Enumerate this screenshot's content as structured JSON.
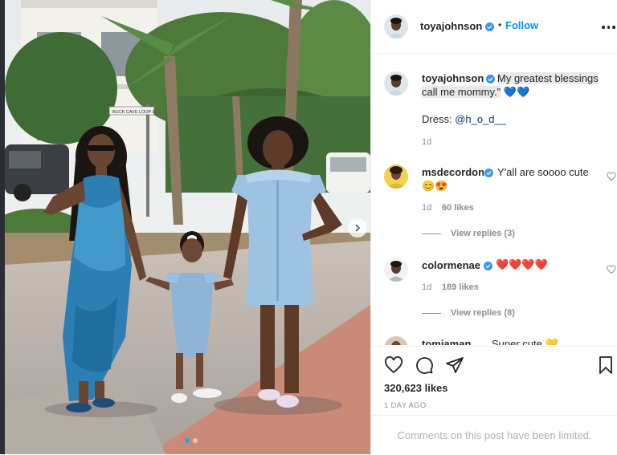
{
  "post": {
    "author": "toyajohnson",
    "follow_label": "Follow",
    "separator": "•"
  },
  "caption": {
    "username": "toyajohnson",
    "line1": "My greatest blessings",
    "line2": "call me mommy.\"",
    "line2_emoji": "💙💙",
    "dress_label": "Dress:",
    "dress_handle": "@h_o_d__",
    "age": "1d"
  },
  "comments": [
    {
      "username": "msdecordon",
      "text": "Y'all are soooo cute",
      "emoji_line": "😊😍",
      "age": "1d",
      "likes": "60 likes",
      "replies": "View replies (3)"
    },
    {
      "username": "colormenae",
      "emoji_line": "❤️❤️❤️❤️",
      "age": "1d",
      "likes": "189 likes",
      "replies": "View replies (8)"
    },
    {
      "username": "tomiaman",
      "text": "Super cute 💛"
    }
  ],
  "footer": {
    "likes": "320,623 likes",
    "timestamp": "1 DAY AGO",
    "comments_limited": "Comments on this post have been limited."
  },
  "photo": {
    "sign_text": "BUCK CAVE LOOP E"
  },
  "colors": {
    "accent": "#0095f6",
    "verified": "#3897f0",
    "heart": "#ed4956",
    "text": "#262626",
    "muted": "#8e8e8e"
  }
}
